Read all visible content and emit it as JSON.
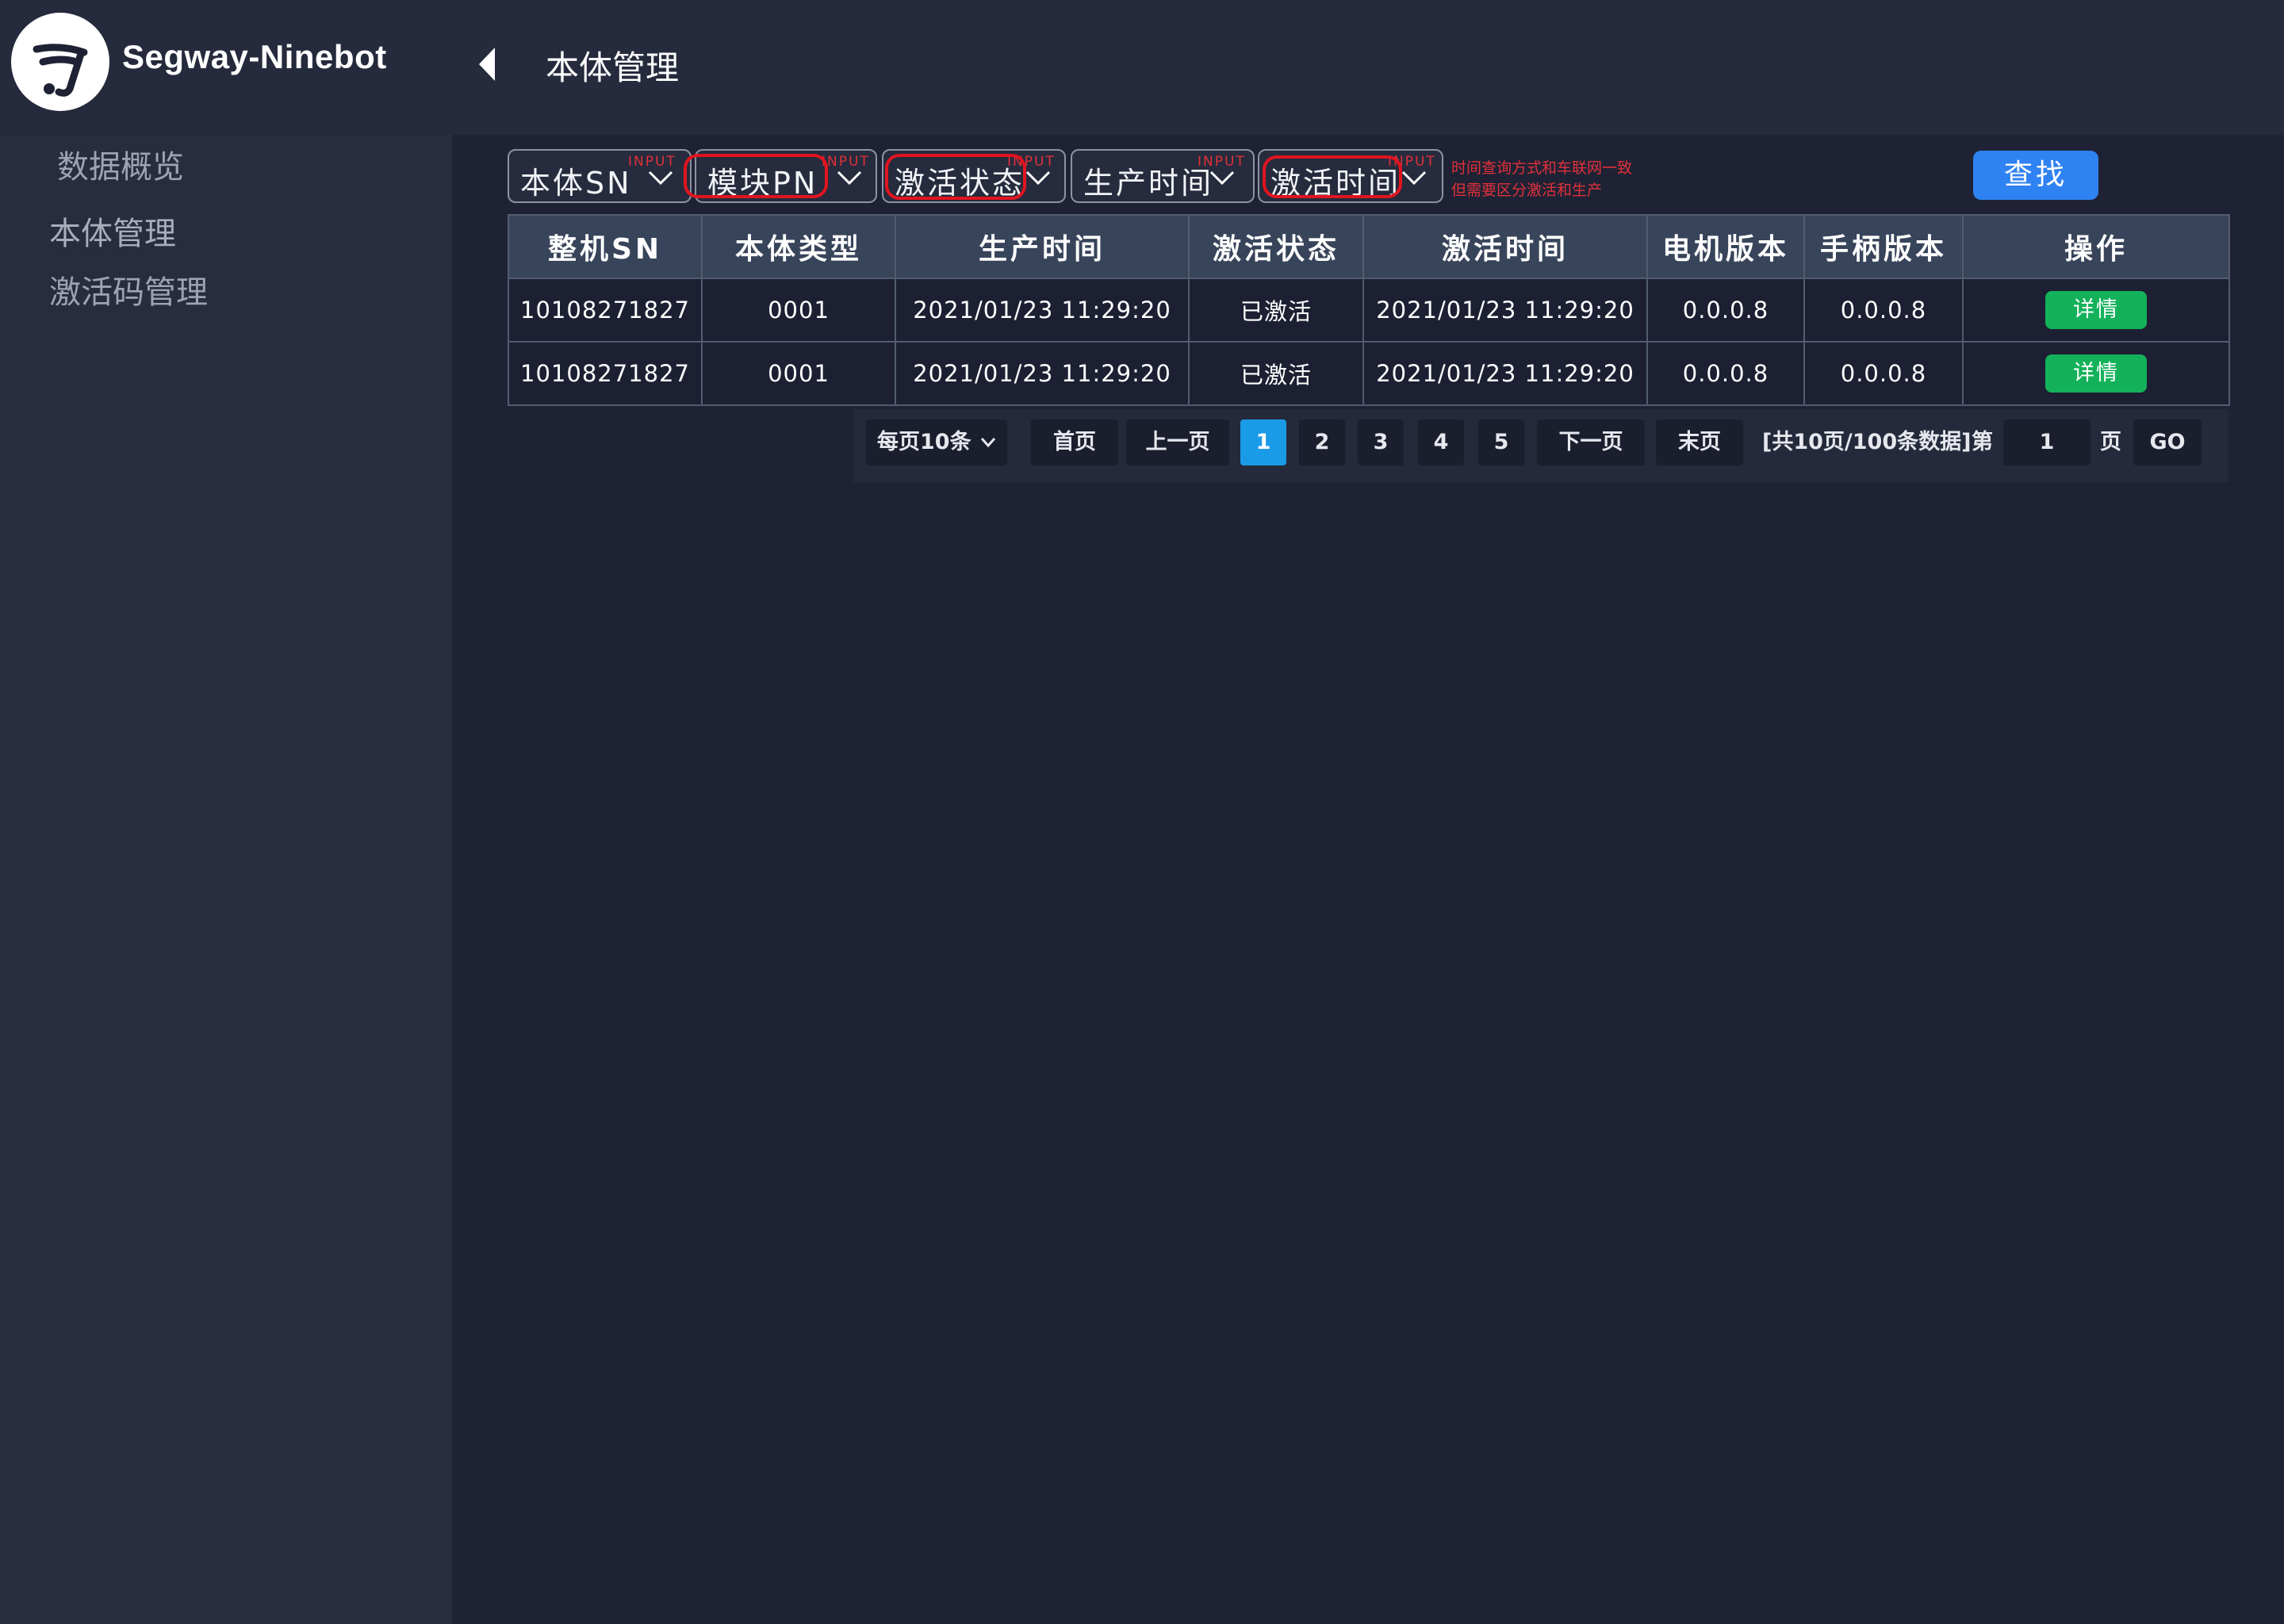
{
  "brand": {
    "name": "Segway-Ninebot"
  },
  "header": {
    "title": "本体管理"
  },
  "sidebar": {
    "items": [
      {
        "label": "数据概览"
      },
      {
        "label": "本体管理"
      },
      {
        "label": "激活码管理"
      }
    ]
  },
  "filters": [
    {
      "label": "本体SN",
      "tag": "INPUT"
    },
    {
      "label": "模块PN",
      "tag": "INPUT"
    },
    {
      "label": "激活状态",
      "tag": "INPUT"
    },
    {
      "label": "生产时间",
      "tag": "INPUT"
    },
    {
      "label": "激活时间",
      "tag": "INPUT"
    }
  ],
  "note": {
    "line1": "时间查询方式和车联网一致",
    "line2": "但需要区分激活和生产"
  },
  "search_button": {
    "label": "查找"
  },
  "table": {
    "headers": [
      "整机SN",
      "本体类型",
      "生产时间",
      "激活状态",
      "激活时间",
      "电机版本",
      "手柄版本",
      "操作"
    ],
    "rows": [
      {
        "sn": "10108271827",
        "type": "0001",
        "produced": "2021/01/23 11:29:20",
        "status": "已激活",
        "activated": "2021/01/23 11:29:20",
        "motor": "0.0.0.8",
        "handle": "0.0.0.8",
        "action": "详情"
      },
      {
        "sn": "10108271827",
        "type": "0001",
        "produced": "2021/01/23 11:29:20",
        "status": "已激活",
        "activated": "2021/01/23 11:29:20",
        "motor": "0.0.0.8",
        "handle": "0.0.0.8",
        "action": "详情"
      }
    ]
  },
  "pagination": {
    "page_size": "每页10条",
    "first": "首页",
    "prev": "上一页",
    "pages": [
      "1",
      "2",
      "3",
      "4",
      "5"
    ],
    "current_page": "1",
    "next": "下一页",
    "last": "末页",
    "summary": "[共10页/100条数据]",
    "goto_prefix": "第",
    "goto_value": "1",
    "goto_suffix": "页",
    "go": "GO"
  },
  "colors": {
    "background": "#1f2234",
    "sidebar": "#272c3e",
    "accent_blue": "#2f82f2",
    "page_active": "#1a9be8",
    "detail_green": "#13b15a",
    "annotation_red": "#e0141f"
  }
}
